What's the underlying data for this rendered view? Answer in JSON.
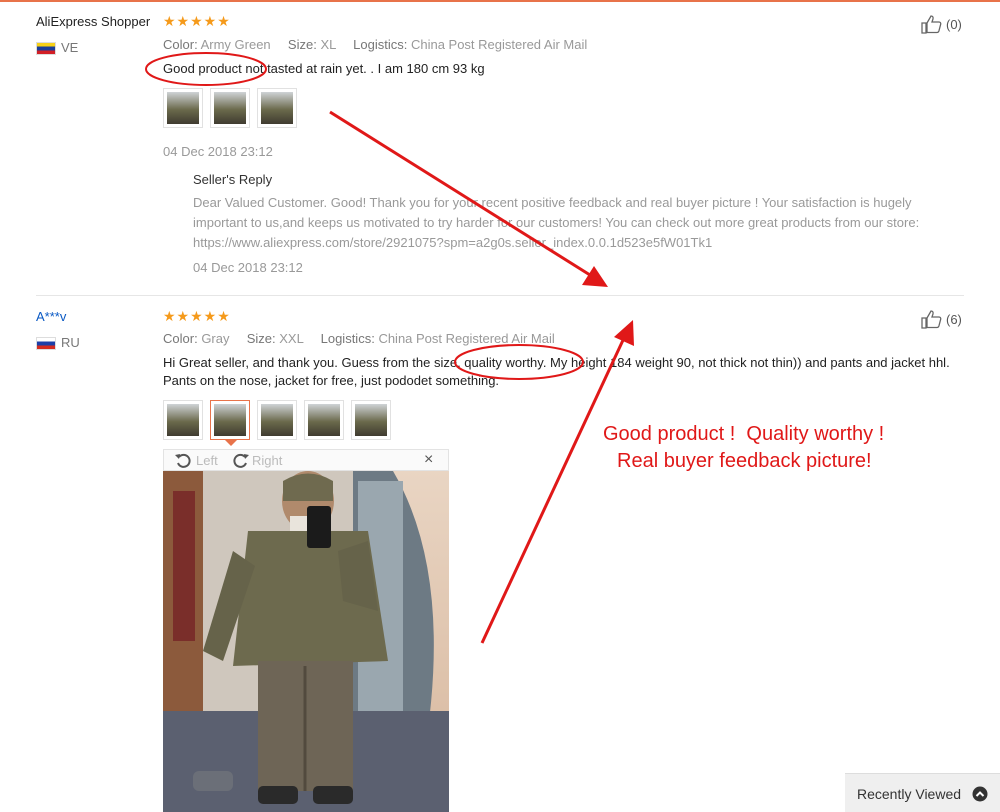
{
  "reviews": [
    {
      "user": "AliExpress Shopper",
      "country": "VE",
      "stars": "★★★★★",
      "color_label": "Color:",
      "color_value": "Army Green",
      "size_label": "Size:",
      "size_value": "XL",
      "logistics_label": "Logistics:",
      "logistics_value": "China Post Registered Air Mail",
      "text": "Good product not tasted at rain yet. . I am 180 cm 93 kg",
      "date": "04 Dec 2018 23:12",
      "likes": "(0)",
      "reply_title": "Seller's Reply",
      "reply_text": "Dear Valued Customer. Good! Thank you for your recent positive feedback and real buyer picture ! Your satisfaction is hugely important to us,and keeps us motivated to try harder for our customers! You can check out more great products from our store: https://www.aliexpress.com/store/2921075?spm=a2g0s.seller_index.0.0.1d523e5fW01Tk1",
      "reply_date": "04 Dec 2018 23:12"
    },
    {
      "user": "A***v",
      "country": "RU",
      "stars": "★★★★★",
      "color_label": "Color:",
      "color_value": "Gray",
      "size_label": "Size:",
      "size_value": "XXL",
      "logistics_label": "Logistics:",
      "logistics_value": "China Post Registered Air Mail",
      "text": "Hi Great seller, and thank you. Guess from the size, quality worthy. My height 184 weight 90, not thick not thin)) and pants and jacket hhl. Pants on the nose, jacket for free, just pododet something.",
      "likes": "(6)"
    }
  ],
  "viewer": {
    "left": "Left",
    "right": "Right",
    "close": "×"
  },
  "annotation": {
    "line1": "Good product !  Quality worthy !",
    "line2": "Real buyer feedback picture!"
  },
  "recently_viewed": "Recently Viewed",
  "colors": {
    "accent": "#e8734a",
    "annotation": "#e01818",
    "star": "#f59a1b",
    "link": "#0a59c4"
  }
}
